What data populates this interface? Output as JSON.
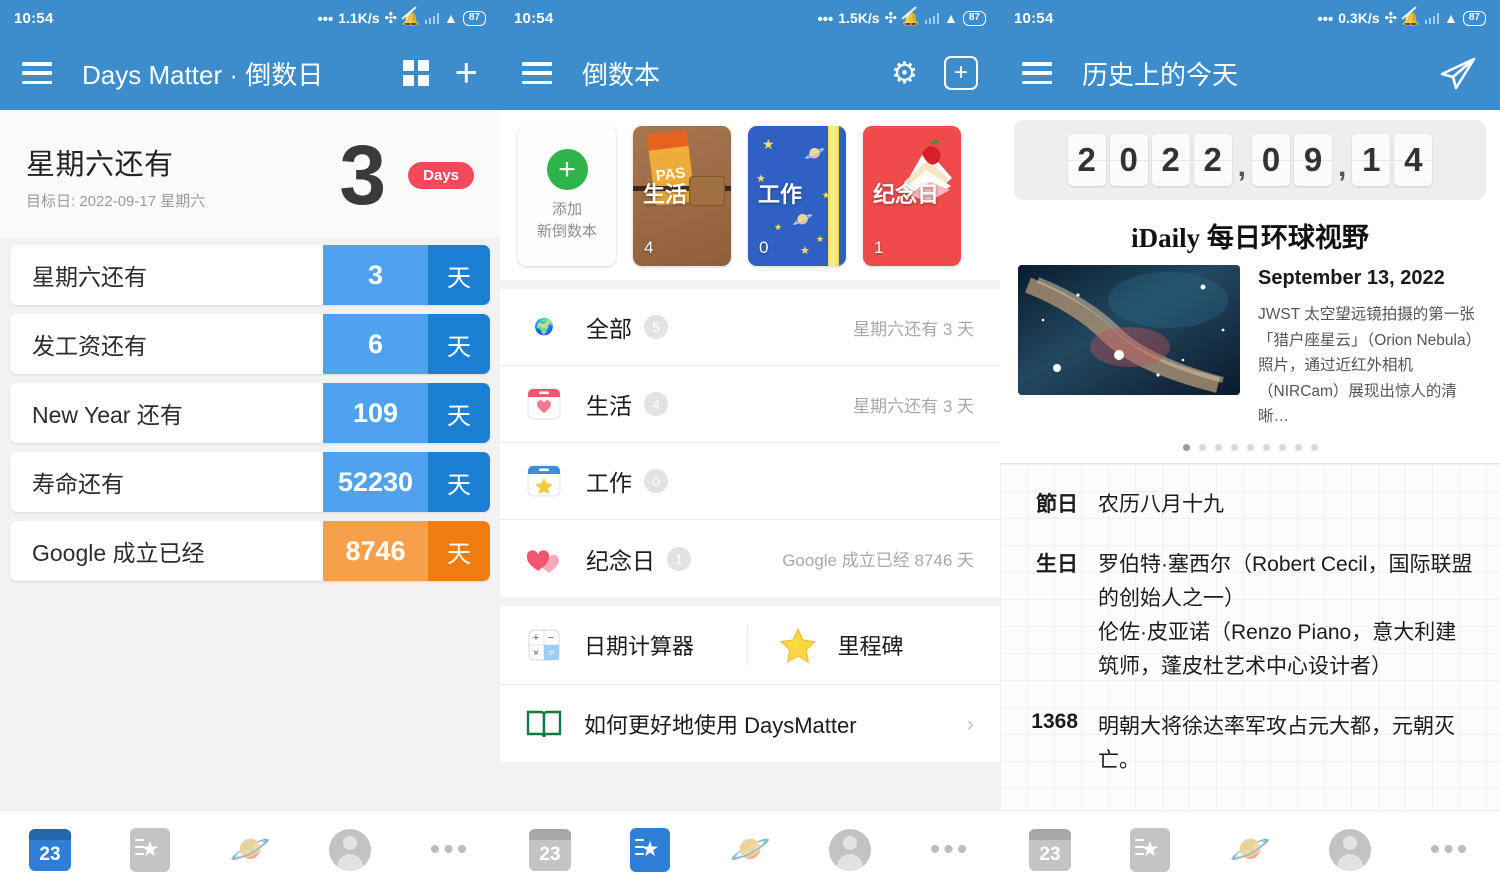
{
  "status": {
    "time": "10:54",
    "speeds": [
      "1.1K/s",
      "1.5K/s",
      "0.3K/s"
    ],
    "battery": "87",
    "bluetooth_icon": "bluetooth-icon",
    "mute_icon": "mute-bell-icon",
    "signal_icon": "signal-bars-icon",
    "wifi_icon": "wifi-icon"
  },
  "screen1": {
    "appbar": {
      "title": "Days Matter · 倒数日",
      "menu_icon": "hamburger-menu-icon",
      "grid_icon": "grid-view-icon",
      "add_icon": "plus-icon"
    },
    "hero": {
      "title": "星期六还有",
      "subtitle": "目标日: 2022-09-17 星期六",
      "number": "3",
      "badge": "Days"
    },
    "countdowns": [
      {
        "name": "星期六还有",
        "value": "3",
        "unit": "天",
        "color": "blue"
      },
      {
        "name": "发工资还有",
        "value": "6",
        "unit": "天",
        "color": "blue"
      },
      {
        "name": "New Year 还有",
        "value": "109",
        "unit": "天",
        "color": "blue"
      },
      {
        "name": "寿命还有",
        "value": "52230",
        "unit": "天",
        "color": "blue"
      },
      {
        "name": "Google 成立已经",
        "value": "8746",
        "unit": "天",
        "color": "orange"
      }
    ]
  },
  "screen2": {
    "appbar": {
      "title": "倒数本",
      "menu_icon": "hamburger-menu-icon",
      "settings_icon": "gear-icon",
      "add_icon": "add-box-icon"
    },
    "books": [
      {
        "label": "添加",
        "label2": "新倒数本",
        "count": "",
        "type": "add"
      },
      {
        "label": "生活",
        "count": "4",
        "type": "life"
      },
      {
        "label": "工作",
        "count": "0",
        "type": "work"
      },
      {
        "label": "纪念日",
        "count": "1",
        "type": "anniversary"
      }
    ],
    "categories": [
      {
        "icon": "globe-icon",
        "name": "全部",
        "badge": "5",
        "right": "星期六还有 3 天"
      },
      {
        "icon": "calendar-heart-icon",
        "name": "生活",
        "badge": "4",
        "right": "星期六还有 3 天"
      },
      {
        "icon": "calendar-star-icon",
        "name": "工作",
        "badge": "0",
        "right": ""
      },
      {
        "icon": "two-hearts-icon",
        "name": "纪念日",
        "badge": "1",
        "right": "Google 成立已经 8746 天"
      }
    ],
    "tools": [
      {
        "icon": "calculator-icon",
        "label": "日期计算器"
      },
      {
        "icon": "star-icon",
        "label": "里程碑"
      }
    ],
    "help": {
      "icon": "open-book-icon",
      "label": "如何更好地使用 DaysMatter",
      "chevron": "›"
    }
  },
  "screen3": {
    "appbar": {
      "title": "历史上的今天",
      "menu_icon": "hamburger-menu-icon",
      "share_icon": "paper-plane-icon"
    },
    "flipdate": {
      "digits": [
        "2",
        "0",
        "2",
        "2",
        ",",
        "0",
        "9",
        ",",
        "1",
        "4"
      ]
    },
    "idaily_title": "iDaily 每日环球视野",
    "news": {
      "date": "September 13, 2022",
      "desc": "JWST 太空望远镜拍摄的第一张「猎户座星云」（Orion Nebula）照片，通过近红外相机（NIRCam）展现出惊人的清晰…",
      "dots_total": 9,
      "dots_active": 0
    },
    "history": [
      {
        "label": "節日",
        "text": "农历八月十九"
      },
      {
        "label": "生日",
        "text": "罗伯特·塞西尔（Robert Cecil，国际联盟的创始人之一）\n伦佐·皮亚诺（Renzo Piano，意大利建筑师，蓬皮杜艺术中心设计者）"
      },
      {
        "label": "1368",
        "text": "明朝大将徐达率军攻占元大都，元朝灭亡。"
      }
    ]
  },
  "bottomnav": {
    "items": [
      {
        "icon": "calendar-23-icon",
        "label": "23"
      },
      {
        "icon": "countdown-book-icon",
        "label": "★"
      },
      {
        "icon": "saturn-planet-icon",
        "label": "🪐"
      },
      {
        "icon": "profile-avatar-icon",
        "label": ""
      },
      {
        "icon": "more-dots-icon",
        "label": "•••"
      }
    ],
    "active_per_screen": [
      0,
      1,
      2
    ]
  },
  "colors": {
    "brand_blue": "#3d8ccc",
    "badge_red": "#f5485a",
    "row_blue_light": "#4fa3ee",
    "row_blue_dark": "#1b7fd4",
    "row_orange_light": "#f6a14a",
    "row_orange_dark": "#f07d10"
  }
}
